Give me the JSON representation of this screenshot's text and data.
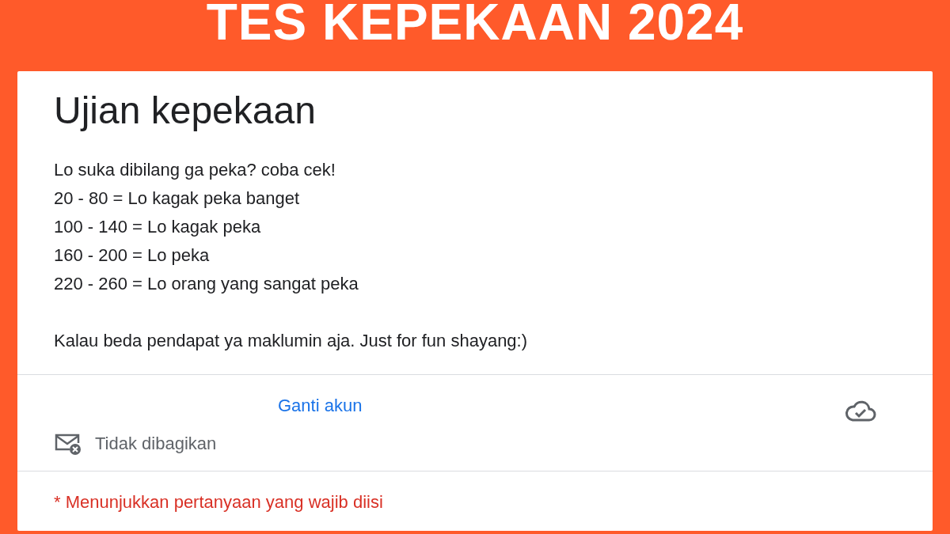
{
  "banner": {
    "title": "TES KEPEKAAN 2024"
  },
  "form": {
    "title": "Ujian kepekaan",
    "description": [
      "Lo suka dibilang ga peka? coba cek!",
      "20 - 80 = Lo kagak peka banget",
      "100 - 140 = Lo kagak peka",
      "160 - 200 = Lo peka",
      "220 - 260 = Lo orang yang sangat peka"
    ],
    "note": "Kalau beda pendapat ya maklumin aja. Just for fun shayang:)"
  },
  "account": {
    "switch_link": "Ganti akun",
    "sharing": "Tidak dibagikan",
    "saved": true
  },
  "required_notice": "* Menunjukkan pertanyaan yang wajib diisi"
}
